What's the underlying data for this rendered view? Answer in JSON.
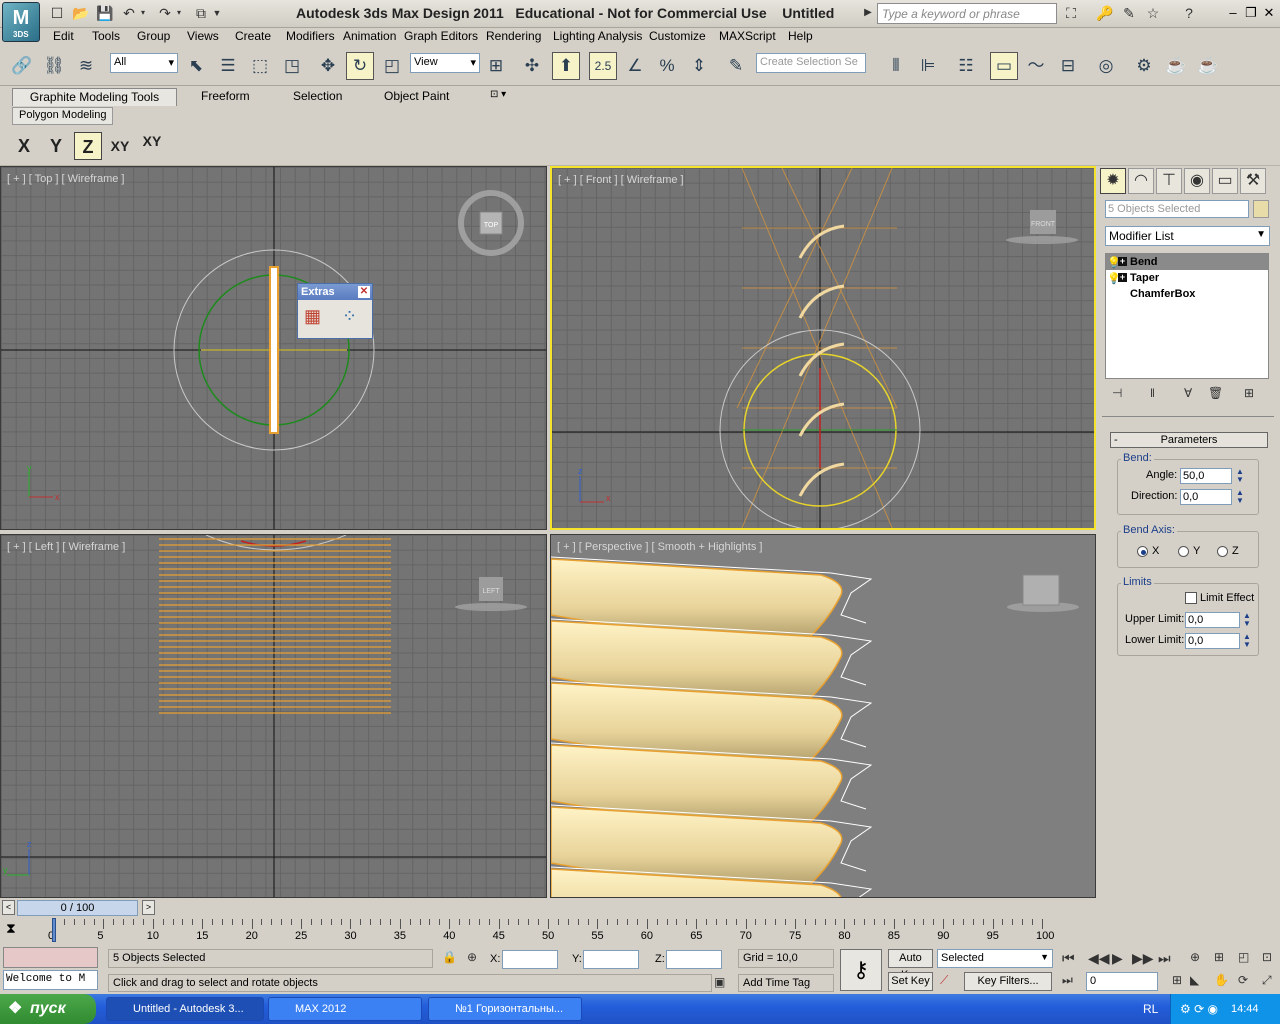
{
  "app": {
    "logo_text": "3DS",
    "title": "Autodesk 3ds Max Design 2011   Educational - Not for Commercial Use    Untitled",
    "search_placeholder": "Type a keyword or phrase"
  },
  "menu": [
    "Edit",
    "Tools",
    "Group",
    "Views",
    "Create",
    "Modifiers",
    "Animation",
    "Graph Editors",
    "Rendering",
    "Lighting Analysis",
    "Customize",
    "MAXScript",
    "Help"
  ],
  "toolbar": {
    "selection_filter": "All",
    "ref_coord": "View",
    "snap_value": "2.5",
    "named_selection_placeholder": "Create Selection Se"
  },
  "ribbon": {
    "tabs": [
      "Graphite Modeling Tools",
      "Freeform",
      "Selection",
      "Object Paint"
    ],
    "subtab": "Polygon Modeling"
  },
  "axis_constraints": [
    "X",
    "Y",
    "Z",
    "XY",
    "XY"
  ],
  "viewports": {
    "top": "[ + ] [ Top ] [ Wireframe ]",
    "front": "[ + ] [ Front ] [ Wireframe ]",
    "left": "[ + ] [ Left ] [ Wireframe ]",
    "perspective": "[ + ] [ Perspective ] [ Smooth + Highlights ]",
    "viewcube_top": "TOP",
    "viewcube_front": "FRONT",
    "viewcube_left": "LEFT"
  },
  "extras_panel": {
    "title": "Extras"
  },
  "command_panel": {
    "selection_info": "5 Objects Selected",
    "modifier_list": "Modifier List",
    "stack": [
      "Bend",
      "Taper",
      "ChamferBox"
    ],
    "rollout_title": "Parameters",
    "bend_group": "Bend:",
    "angle_label": "Angle:",
    "angle_value": "50,0",
    "direction_label": "Direction:",
    "direction_value": "0,0",
    "bend_axis_group": "Bend Axis:",
    "axes": [
      "X",
      "Y",
      "Z"
    ],
    "selected_axis": "X",
    "limits_group": "Limits",
    "limit_effect_label": "Limit Effect",
    "upper_limit_label": "Upper Limit:",
    "upper_limit_value": "0,0",
    "lower_limit_label": "Lower Limit:",
    "lower_limit_value": "0,0"
  },
  "timeline": {
    "position": "0 / 100",
    "ticks": [
      "0",
      "5",
      "10",
      "15",
      "20",
      "25",
      "30",
      "35",
      "40",
      "45",
      "50",
      "55",
      "60",
      "65",
      "70",
      "75",
      "80",
      "85",
      "90",
      "95",
      "100"
    ]
  },
  "status": {
    "maxscript_text": "Welcome to M",
    "selected_text": "5 Objects Selected",
    "prompt_text": "Click and drag to select and rotate objects",
    "x_label": "X:",
    "y_label": "Y:",
    "z_label": "Z:",
    "grid": "Grid = 10,0",
    "add_time_tag": "Add Time Tag",
    "auto_key": "Auto Key",
    "set_key": "Set Key",
    "key_mode": "Selected",
    "key_filters": "Key Filters...",
    "frame_value": "0"
  },
  "taskbar": {
    "start": "пуск",
    "tasks": [
      "Untitled - Autodesk 3...",
      "MAX 2012",
      "№1 Горизонтальны..."
    ],
    "lang": "RL",
    "clock": "14:44"
  },
  "colors": {
    "viewport_bg": "#747474",
    "grid": "#646464",
    "active_border": "#f4e32a",
    "selection": "#e8a030",
    "blind_color": "#e8d5a0"
  }
}
